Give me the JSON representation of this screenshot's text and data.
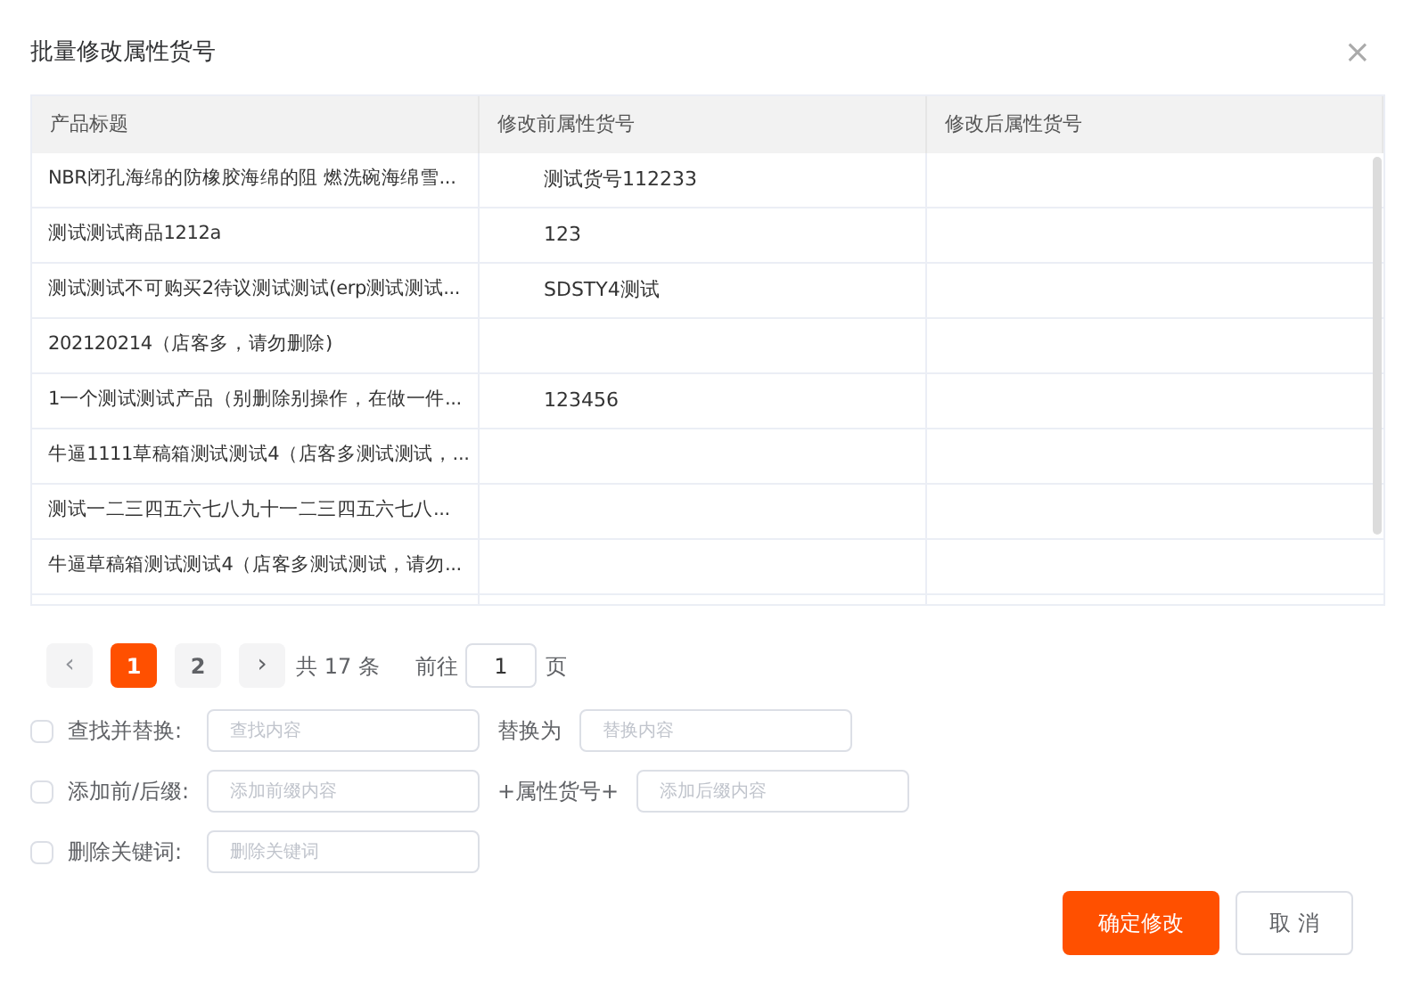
{
  "dialog": {
    "title": "批量修改属性货号",
    "close": "×"
  },
  "table": {
    "columns": [
      "产品标题",
      "修改前属性货号",
      "修改后属性货号"
    ],
    "rows": [
      {
        "title": "NBR闭孔海绵的防橡胶海绵的阻 燃洗碗海绵雪...",
        "before": "测试货号112233"
      },
      {
        "title": "测试测试商品1212a",
        "before": "123"
      },
      {
        "title": "测试测试不可购买2待议测试测试(erp测试测试...",
        "before": "SDSTY4测试"
      },
      {
        "title": "202120214（店客多，请勿删除)"
      },
      {
        "title": "1一个测试测试产品（别删除别操作，在做一件...",
        "before": "123456"
      },
      {
        "title": "牛逼1111草稿箱测试测试4（店客多测试测试，..."
      },
      {
        "title": "测试一二三四五六七八九十一二三四五六七八..."
      },
      {
        "title": "牛逼草稿箱测试测试4（店客多测试测试，请勿..."
      }
    ]
  },
  "pagination": {
    "prev": "‹",
    "pages": [
      {
        "label": "1",
        "selected": true
      },
      {
        "label": "2",
        "selected": false
      }
    ],
    "next": "›",
    "total": "共 17 条",
    "goto_label": "前往",
    "goto_value": "1",
    "goto_suffix": "页"
  },
  "options": [
    {
      "checked": false,
      "label": "查找并替换:",
      "first_placeholder": "查找内容",
      "middle": "替换为",
      "second_placeholder": "替换内容"
    },
    {
      "checked": false,
      "label": "添加前/后缀:",
      "first_placeholder": "添加前缀内容",
      "middle": "+属性货号+",
      "second_placeholder": "添加后缀内容"
    },
    {
      "checked": false,
      "label": "删除关键词:",
      "first_placeholder": "删除关键词"
    }
  ],
  "buttons": [
    {
      "label": "确定修改",
      "kind": "primary"
    },
    {
      "label": "取 消",
      "kind": "secondary"
    }
  ]
}
